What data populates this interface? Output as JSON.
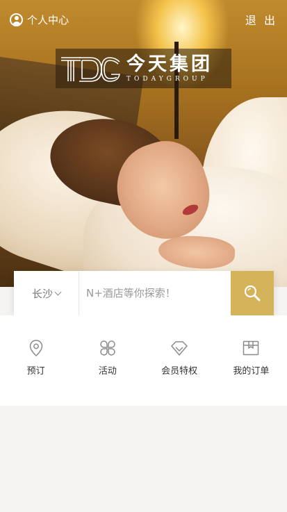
{
  "header": {
    "user_center_label": "个人中心",
    "logout_label": "退 出"
  },
  "logo": {
    "mark_text": "TDG",
    "name_cn": "今天集团",
    "name_en": "TODAYGROUP"
  },
  "search": {
    "city": "长沙",
    "placeholder": "N+酒店等你探索！"
  },
  "menu": {
    "items": [
      {
        "label": "预订",
        "icon": "location-pin-icon"
      },
      {
        "label": "活动",
        "icon": "clover-icon"
      },
      {
        "label": "会员特权",
        "icon": "diamond-icon"
      },
      {
        "label": "我的订单",
        "icon": "order-box-icon"
      }
    ]
  },
  "colors": {
    "accent": "#d4b35a",
    "background": "#f5f4f2"
  }
}
